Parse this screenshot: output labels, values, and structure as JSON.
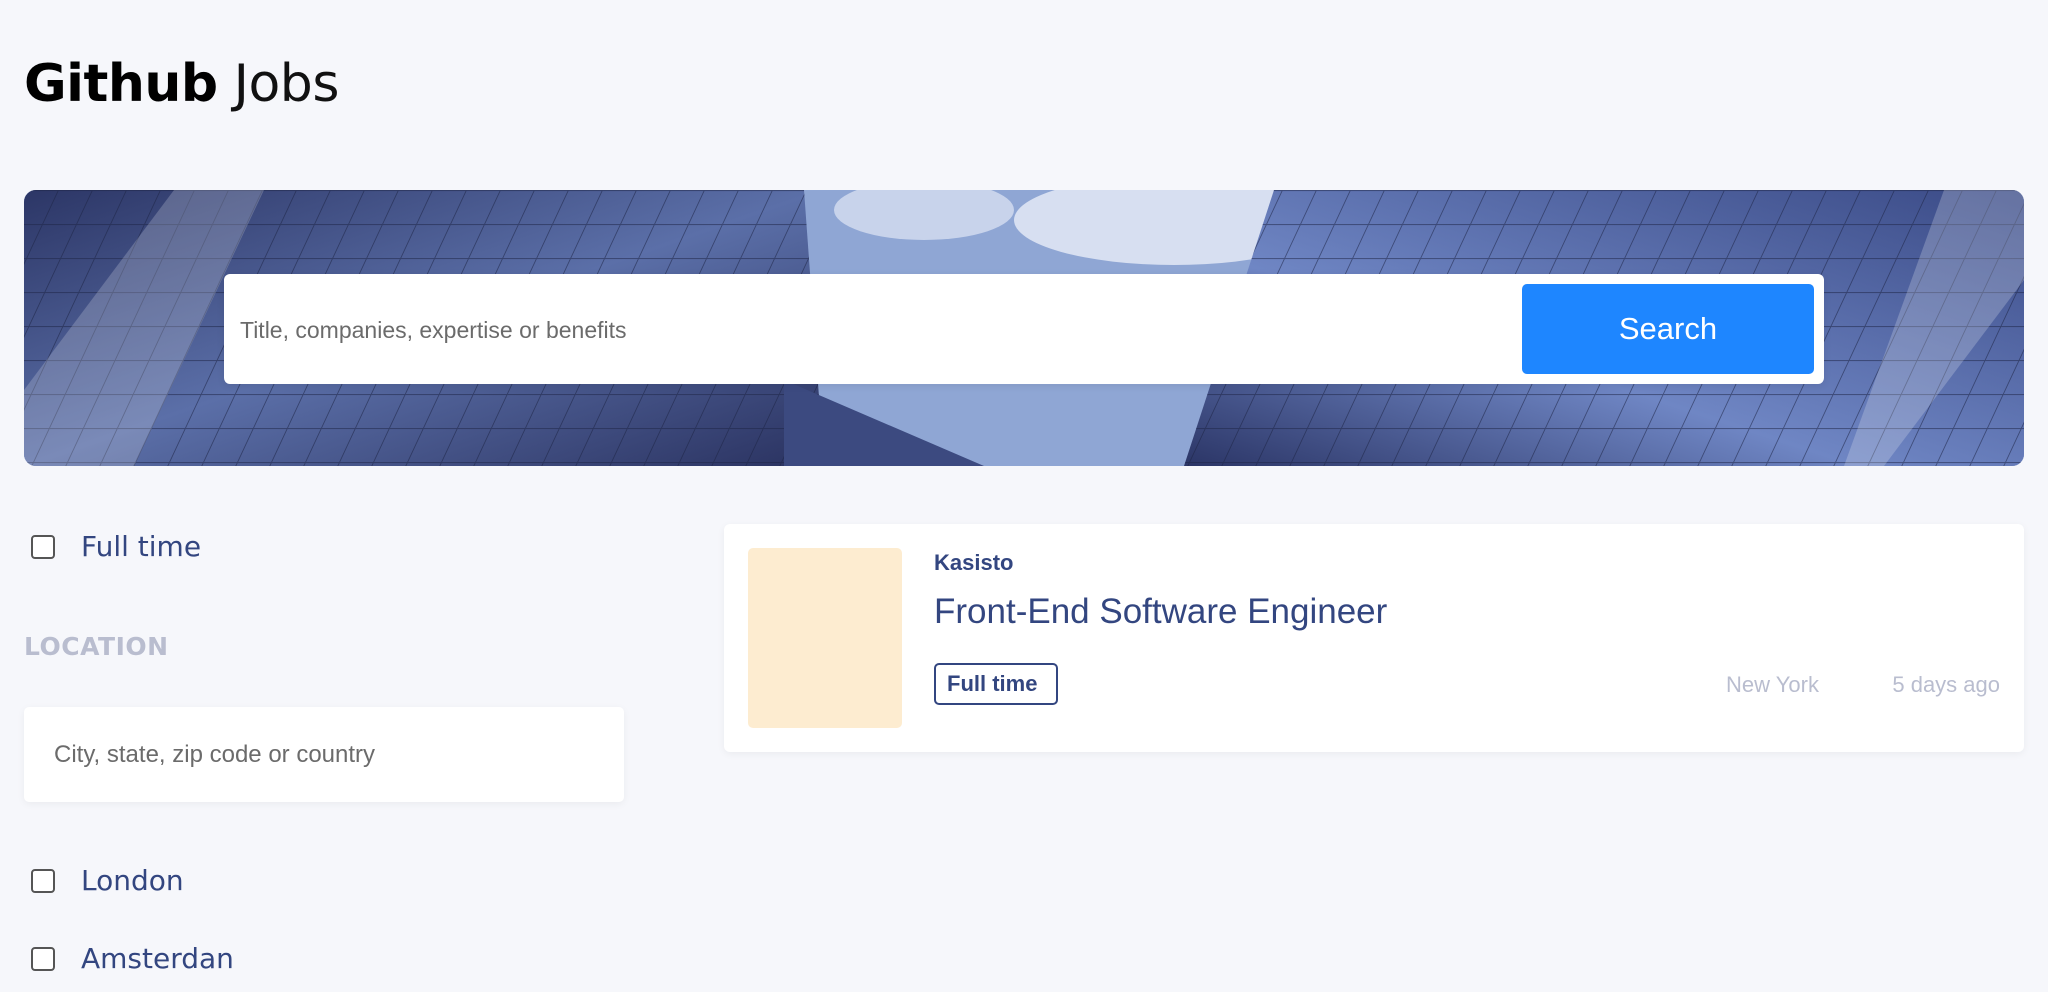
{
  "header": {
    "logo_bold": "Github",
    "logo_light": "Jobs"
  },
  "search": {
    "placeholder": "Title, companies, expertise or benefits",
    "value": "",
    "button_label": "Search"
  },
  "filters": {
    "full_time_label": "Full time",
    "full_time_checked": false,
    "location_title": "LOCATION",
    "location_placeholder": "City, state, zip code or country",
    "location_value": "",
    "cities": [
      {
        "label": "London",
        "checked": false
      },
      {
        "label": "Amsterdan",
        "checked": false
      }
    ]
  },
  "jobs": [
    {
      "company": "Kasisto",
      "title": "Front-End Software Engineer",
      "tag": "Full time",
      "location": "New York",
      "posted": "5 days ago",
      "logo_color": "#fdecd0"
    }
  ],
  "colors": {
    "background": "#f6f7fb",
    "accent": "#1e86ff",
    "text_primary": "#334680",
    "text_muted": "#b9bdcf"
  }
}
